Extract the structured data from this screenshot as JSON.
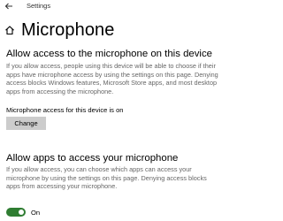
{
  "window": {
    "title": "Settings",
    "back_icon": "back-arrow-icon"
  },
  "header": {
    "home_icon": "home-icon",
    "title": "Microphone"
  },
  "device_access": {
    "title": "Allow access to the microphone on this device",
    "description": "If you allow access, people using this device will be able to choose if their apps have microphone access by using the settings on this page. Denying access blocks Windows features, Microsoft Store apps, and most desktop apps from accessing the microphone.",
    "status": "Microphone access for this device is on",
    "change_label": "Change"
  },
  "app_access": {
    "title": "Allow apps to access your microphone",
    "description": "If you allow access, you can choose which apps can access your microphone by using the settings on this page. Denying access blocks apps from accessing your microphone.",
    "toggle_state_label": "On",
    "toggle_on": true
  },
  "colors": {
    "toggle_on": "#2f7d32",
    "button_bg": "#cccccc",
    "description_text": "#666666"
  }
}
